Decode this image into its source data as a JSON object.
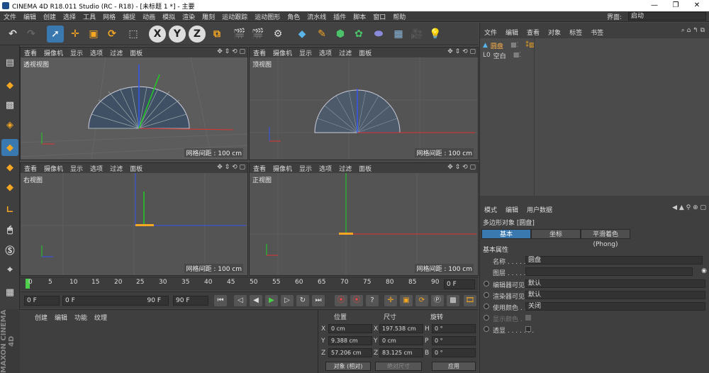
{
  "window": {
    "title": "CINEMA 4D R18.011 Studio (RC - R18) - [未标题 1 *] - 主要"
  },
  "menubar": {
    "items": [
      "文件",
      "编辑",
      "创建",
      "选择",
      "工具",
      "网格",
      "捕捉",
      "动画",
      "模拟",
      "渲染",
      "雕刻",
      "运动跟踪",
      "运动图形",
      "角色",
      "流水线",
      "插件",
      "脚本",
      "窗口",
      "帮助"
    ],
    "layout_label": "界面:",
    "layout_value": "启动"
  },
  "toolbar": {
    "x": "X",
    "y": "Y",
    "z": "Z"
  },
  "viewports": [
    {
      "menu": [
        "查看",
        "摄像机",
        "显示",
        "选项",
        "过滤",
        "面板"
      ],
      "label": "透视视图",
      "grid": "网格间距 : 100 cm"
    },
    {
      "menu": [
        "查看",
        "摄像机",
        "显示",
        "选项",
        "过滤",
        "面板"
      ],
      "label": "顶视图",
      "grid": "网格间距 : 100 cm"
    },
    {
      "menu": [
        "查看",
        "摄像机",
        "显示",
        "选项",
        "过滤",
        "面板"
      ],
      "label": "右视图",
      "grid": "网格间距 : 100 cm"
    },
    {
      "menu": [
        "查看",
        "摄像机",
        "显示",
        "选项",
        "过滤",
        "面板"
      ],
      "label": "正视图",
      "grid": "网格间距 : 100 cm"
    }
  ],
  "object_manager": {
    "menu": [
      "文件",
      "编辑",
      "查看",
      "对象",
      "标签",
      "书签"
    ],
    "objects": [
      {
        "name": "圆盘"
      },
      {
        "name": "空白"
      }
    ]
  },
  "attribute_manager": {
    "menu": [
      "模式",
      "编辑",
      "用户数据"
    ],
    "object_title": "多边形对象 [圆盘]",
    "tabs": [
      "基本",
      "坐标",
      "平滑着色(Phong)"
    ],
    "section": "基本属性",
    "props": [
      {
        "label": "名称 . . . . . . .",
        "value": "圆盘"
      },
      {
        "label": "图层 . . . . . . .",
        "value": ""
      },
      {
        "label": "编辑器可见",
        "value": "默认"
      },
      {
        "label": "渲染器可见",
        "value": "默认"
      },
      {
        "label": "使用颜色 . . .",
        "value": "关闭"
      },
      {
        "label": "显示颜色 .",
        "value": ""
      },
      {
        "label": "透显 . . . . . . .",
        "value": ""
      }
    ]
  },
  "timeline": {
    "ticks": [
      "0",
      "5",
      "10",
      "15",
      "20",
      "25",
      "30",
      "35",
      "40",
      "45",
      "50",
      "55",
      "60",
      "65",
      "70",
      "75",
      "80",
      "85",
      "90"
    ],
    "end_frame": "0 F"
  },
  "playback": {
    "start": "0 F",
    "range_start": "0 F",
    "range_end": "90 F",
    "end": "90 F"
  },
  "material_manager": {
    "menu": [
      "创建",
      "编辑",
      "功能",
      "纹理"
    ]
  },
  "maxon_logo": "MAXON CINEMA 4D",
  "coordinates": {
    "headers": [
      "位置",
      "尺寸",
      "旋转"
    ],
    "rows": [
      {
        "axis": "X",
        "pos": "0 cm",
        "size": "197.538 cm",
        "rot_axis": "H",
        "rot": "0 °"
      },
      {
        "axis": "Y",
        "pos": "9.388 cm",
        "size": "0 cm",
        "rot_axis": "P",
        "rot": "0 °"
      },
      {
        "axis": "Z",
        "pos": "57.206 cm",
        "size": "83.125 cm",
        "rot_axis": "B",
        "rot": "0 °"
      }
    ],
    "mode": "对象 (相对)",
    "size_mode": "绝对尺寸",
    "apply": "应用"
  }
}
